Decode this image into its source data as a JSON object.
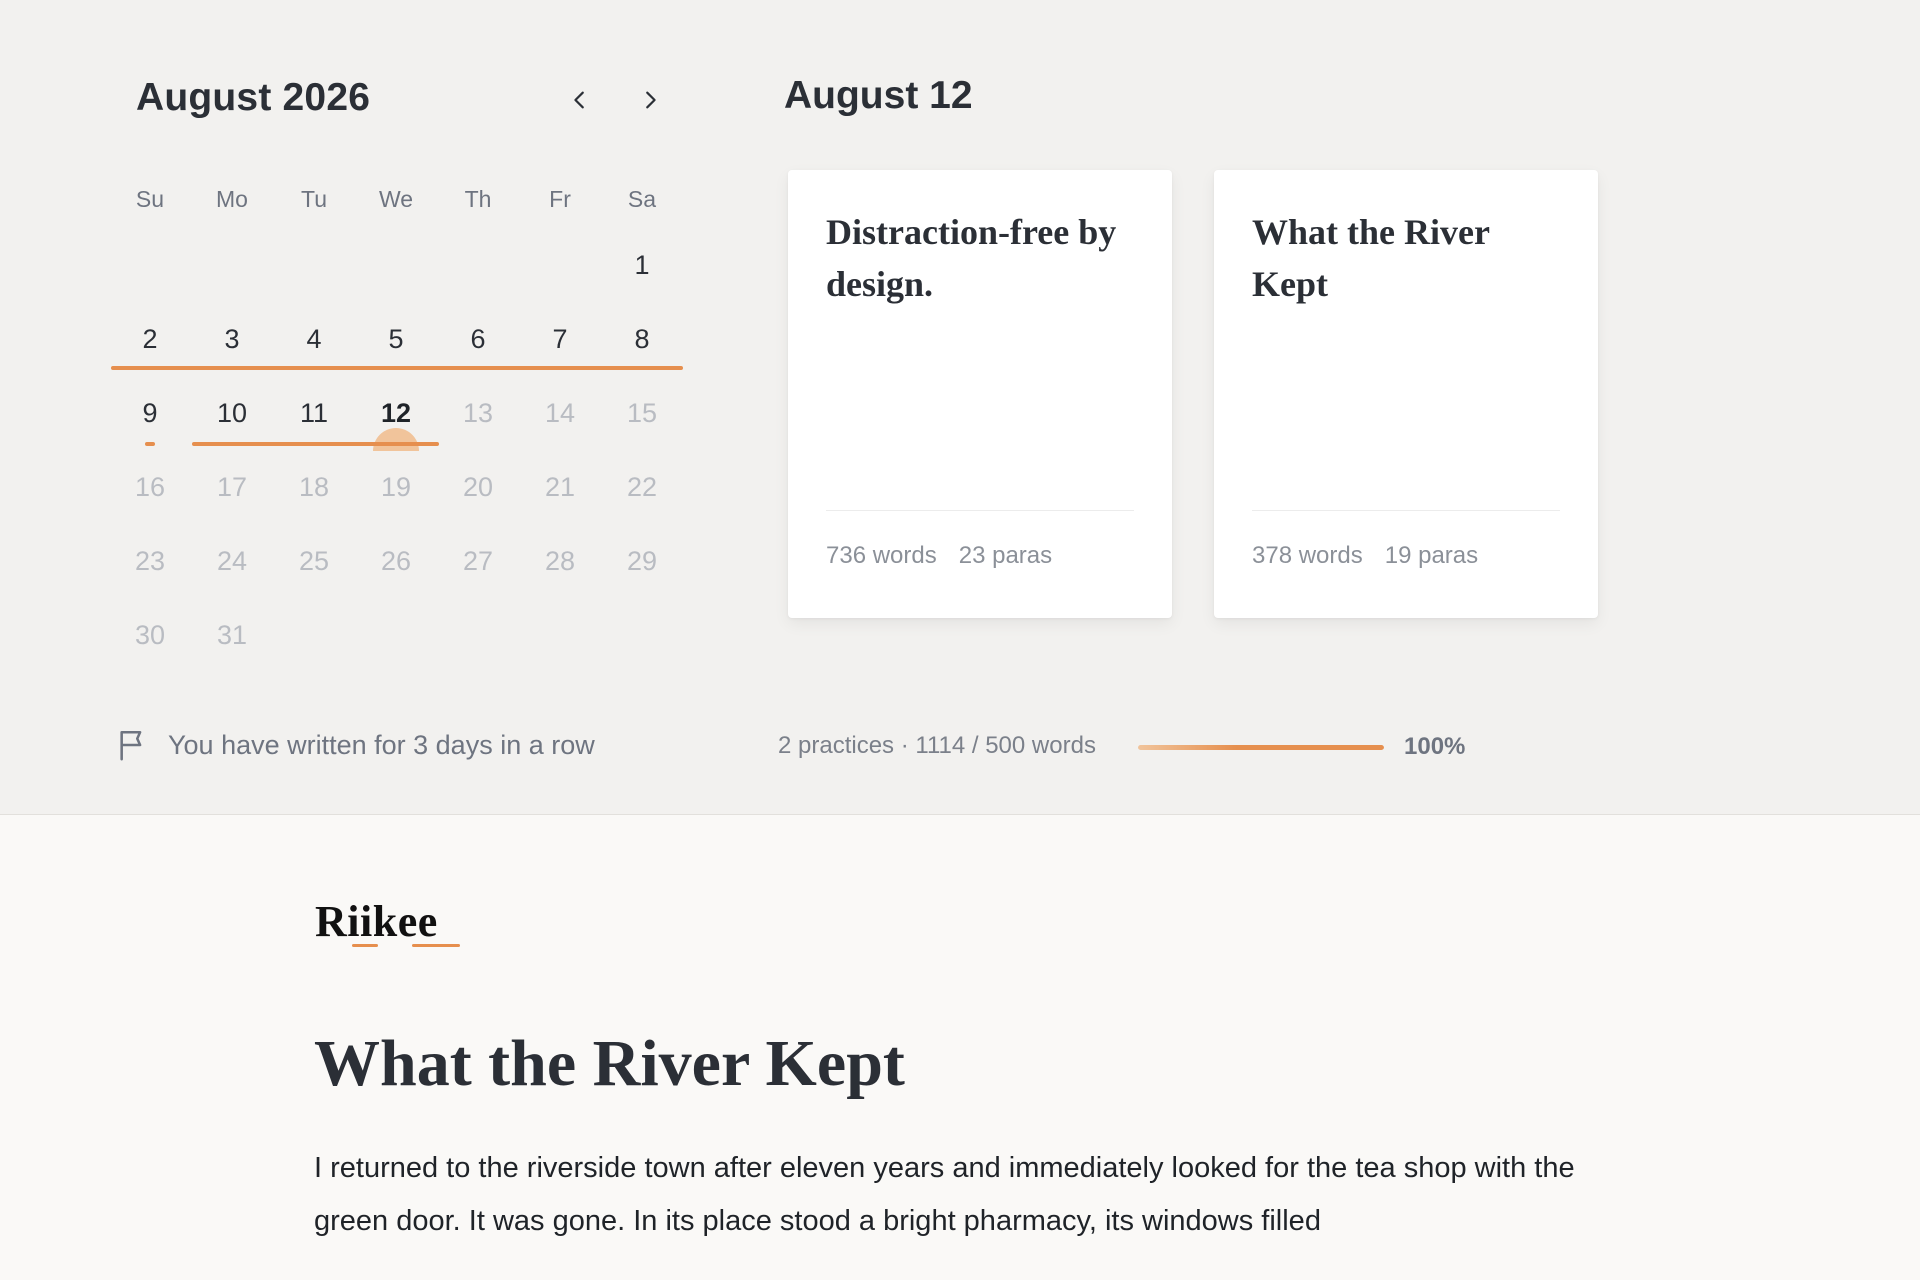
{
  "calendar": {
    "month_title": "August 2026",
    "prev_icon": "chevron-left-icon",
    "next_icon": "chevron-right-icon",
    "weekdays": [
      "Su",
      "Mo",
      "Tu",
      "We",
      "Th",
      "Fr",
      "Sa"
    ],
    "weeks": [
      [
        "",
        "",
        "",
        "",
        "",
        "",
        "1"
      ],
      [
        "2",
        "3",
        "4",
        "5",
        "6",
        "7",
        "8"
      ],
      [
        "9",
        "10",
        "11",
        "12",
        "13",
        "14",
        "15"
      ],
      [
        "16",
        "17",
        "18",
        "19",
        "20",
        "21",
        "22"
      ],
      [
        "23",
        "24",
        "25",
        "26",
        "27",
        "28",
        "29"
      ],
      [
        "30",
        "31",
        "",
        "",
        "",
        "",
        ""
      ]
    ],
    "today": "12",
    "accent_color": "#e68f4e"
  },
  "day_view": {
    "title": "August 12",
    "cards": [
      {
        "title": "Distraction-free by design.",
        "words": "736 words",
        "paras": "23 paras"
      },
      {
        "title": "What the River Kept",
        "words": "378 words",
        "paras": "19 paras"
      }
    ]
  },
  "footer": {
    "streak_icon": "flag-icon",
    "streak_text": "You have written for 3 days in a row",
    "progress_text": "2 practices · 1114 / 500 words",
    "progress_fraction": 1.0,
    "progress_pct": "100%"
  },
  "document": {
    "logo": "Riikee",
    "title": "What the River Kept",
    "body": "I returned to the riverside town after eleven years and immediately looked for the tea shop with the green door. It was gone. In its place stood a bright pharmacy, its windows filled"
  }
}
